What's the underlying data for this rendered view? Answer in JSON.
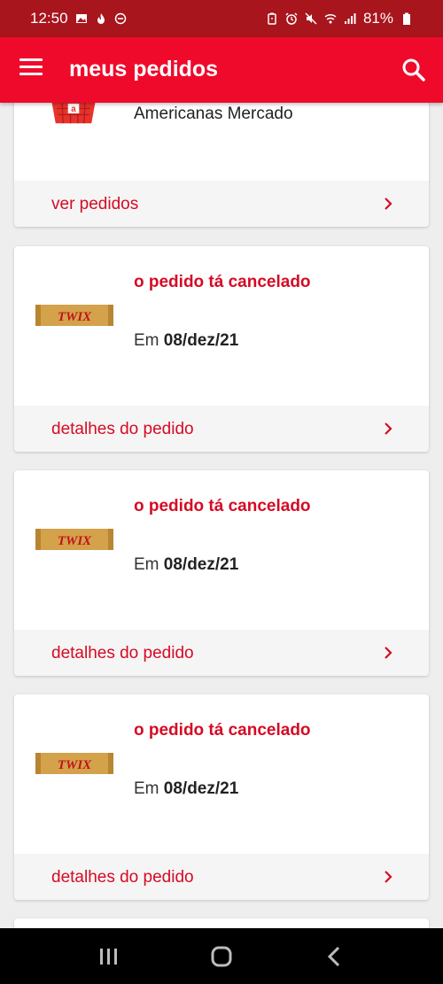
{
  "status_bar": {
    "time": "12:50",
    "battery": "81%"
  },
  "app_bar": {
    "title": "meus pedidos"
  },
  "market_card": {
    "name": "Americanas Mercado",
    "footer_label": "ver pedidos"
  },
  "orders": [
    {
      "status": "o pedido tá cancelado",
      "date_prefix": "Em",
      "date": "08/dez/21",
      "footer_label": "detalhes do pedido",
      "product_logo": "TWIX"
    },
    {
      "status": "o pedido tá cancelado",
      "date_prefix": "Em",
      "date": "08/dez/21",
      "footer_label": "detalhes do pedido",
      "product_logo": "TWIX"
    },
    {
      "status": "o pedido tá cancelado",
      "date_prefix": "Em",
      "date": "08/dez/21",
      "footer_label": "detalhes do pedido",
      "product_logo": "TWIX"
    }
  ],
  "colors": {
    "status_bar": "#a8151c",
    "app_bar": "#ef0a2b",
    "accent": "#d50b24",
    "background": "#eeeeee"
  }
}
